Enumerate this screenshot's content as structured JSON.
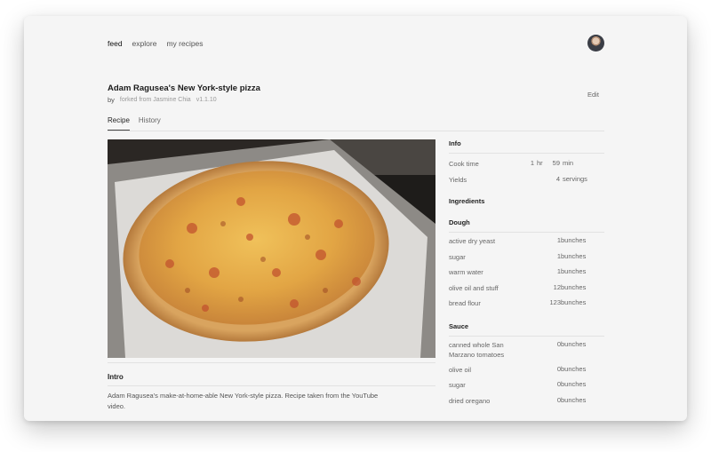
{
  "nav": {
    "items": [
      {
        "label": "feed",
        "active": true
      },
      {
        "label": "explore",
        "active": false
      },
      {
        "label": "my recipes",
        "active": false
      }
    ]
  },
  "recipe": {
    "title": "Adam Ragusea's New York-style pizza",
    "by": "by",
    "forked_from": "forked from Jasmine Chia",
    "version": "v1.1.10"
  },
  "actions": {
    "edit": "Edit"
  },
  "tabs": [
    {
      "label": "Recipe",
      "active": true
    },
    {
      "label": "History",
      "active": false
    }
  ],
  "intro": {
    "heading": "Intro",
    "text": "Adam Ragusea's make-at-home-able New York-style pizza. Recipe taken from the YouTube video."
  },
  "info": {
    "heading": "Info",
    "cook_time": {
      "label": "Cook time",
      "hours": "1",
      "hours_unit": "hr",
      "minutes": "59",
      "minutes_unit": "min"
    },
    "yields": {
      "label": "Yields",
      "value": "4",
      "unit": "servings"
    }
  },
  "ingredients": {
    "heading": "Ingredients",
    "sections": [
      {
        "name": "Dough",
        "items": [
          {
            "name": "active dry yeast",
            "qty": "1",
            "unit": "bunches"
          },
          {
            "name": "sugar",
            "qty": "1",
            "unit": "bunches"
          },
          {
            "name": "warm water",
            "qty": "1",
            "unit": "bunches"
          },
          {
            "name": "olive oil and stuff",
            "qty": "12",
            "unit": "bunches"
          },
          {
            "name": "bread flour",
            "qty": "123",
            "unit": "bunches"
          }
        ]
      },
      {
        "name": "Sauce",
        "items": [
          {
            "name": "canned whole San Marzano tomatoes",
            "qty": "0",
            "unit": "bunches"
          },
          {
            "name": "olive oil",
            "qty": "0",
            "unit": "bunches"
          },
          {
            "name": "sugar",
            "qty": "0",
            "unit": "bunches"
          },
          {
            "name": "dried oregano",
            "qty": "0",
            "unit": "bunches"
          }
        ]
      }
    ]
  },
  "colors": {
    "background": "#f5f5f5",
    "text": "#333333",
    "rule": "#e2e2e2"
  }
}
